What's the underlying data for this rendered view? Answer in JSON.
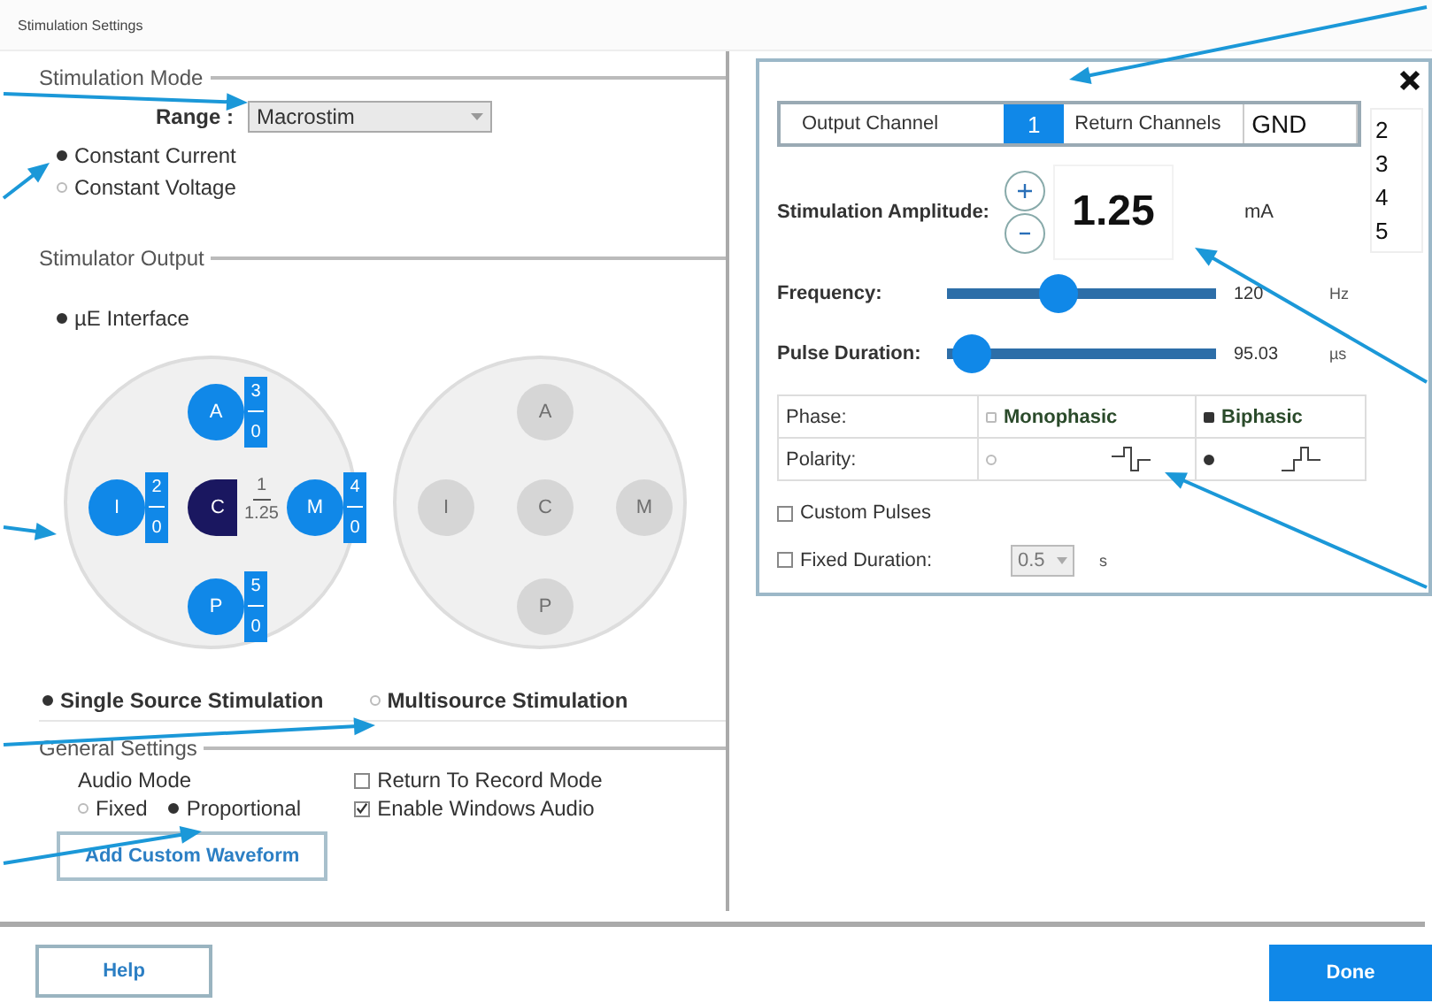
{
  "window": {
    "title": "Stimulation Settings"
  },
  "stimulation_mode": {
    "legend": "Stimulation Mode",
    "range_label": "Range :",
    "range_value": "Macrostim",
    "options": [
      {
        "label": "Constant Current",
        "selected": true
      },
      {
        "label": "Constant Voltage",
        "selected": false
      }
    ]
  },
  "stimulator_output": {
    "legend": "Stimulator Output",
    "interface": {
      "label": "µE Interface",
      "selected": true
    },
    "arrays": [
      {
        "active": true,
        "electrodes": [
          {
            "kind": "contact",
            "letter": "A",
            "channel": "3",
            "value": "0"
          },
          {
            "kind": "contact",
            "letter": "I",
            "channel": "2",
            "value": "0"
          },
          {
            "kind": "center",
            "letter": "C",
            "channel": "1",
            "value": "1.25"
          },
          {
            "kind": "contact",
            "letter": "M",
            "channel": "4",
            "value": "0"
          },
          {
            "kind": "contact",
            "letter": "P",
            "channel": "5",
            "value": "0"
          }
        ]
      },
      {
        "active": false,
        "electrodes": [
          {
            "letter": "A"
          },
          {
            "letter": "I"
          },
          {
            "letter": "C"
          },
          {
            "letter": "M"
          },
          {
            "letter": "P"
          }
        ]
      }
    ],
    "source_options": [
      {
        "label": "Single Source Stimulation",
        "selected": true
      },
      {
        "label": "Multisource Stimulation",
        "selected": false
      }
    ]
  },
  "general_settings": {
    "legend": "General Settings",
    "audio_mode_label": "Audio Mode",
    "audio_modes": [
      {
        "label": "Fixed",
        "selected": false
      },
      {
        "label": "Proportional",
        "selected": true
      }
    ],
    "checkboxes": [
      {
        "label": "Return To Record Mode",
        "checked": false
      },
      {
        "label": "Enable Windows Audio",
        "checked": true
      }
    ]
  },
  "add_waveform_button": "Add Custom Waveform",
  "channel_panel": {
    "output_label": "Output Channel",
    "output_value": "1",
    "return_label": "Return Channels",
    "return_value": "GND",
    "return_options": [
      "2",
      "3",
      "4",
      "5"
    ],
    "amplitude": {
      "label": "Stimulation Amplitude:",
      "value": "1.25",
      "unit": "mA"
    },
    "sliders": [
      {
        "label": "Frequency:",
        "level": 0.4,
        "reading": "120",
        "unit": "Hz"
      },
      {
        "label": "Pulse Duration:",
        "level": 0.02,
        "reading": "95.03",
        "unit": "µs"
      }
    ],
    "phase": {
      "label": "Phase:",
      "options": [
        {
          "label": "Monophasic",
          "selected": false
        },
        {
          "label": "Biphasic",
          "selected": true
        }
      ]
    },
    "polarity": {
      "label": "Polarity:",
      "options": [
        {
          "kind": "negative-first",
          "selected": false
        },
        {
          "kind": "positive-first",
          "selected": true
        }
      ]
    },
    "custom_pulses": {
      "label": "Custom Pulses",
      "checked": false
    },
    "fixed_duration": {
      "label": "Fixed Duration:",
      "checked": false,
      "value": "0.5",
      "unit": "s"
    }
  },
  "buttons": {
    "help": "Help",
    "done": "Done"
  }
}
